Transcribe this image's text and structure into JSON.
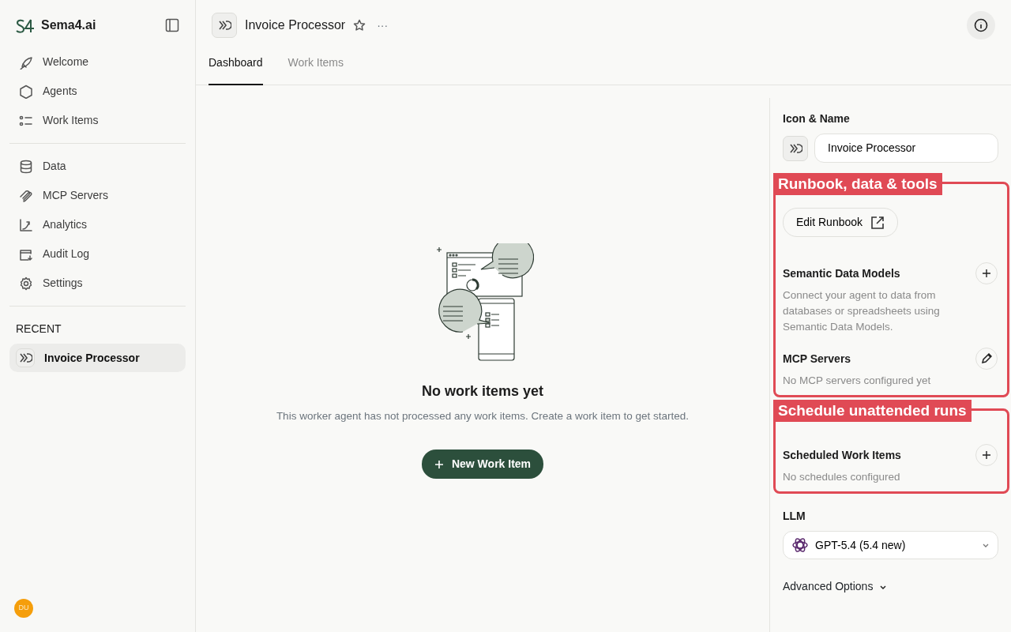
{
  "brand": {
    "name": "Sema4.ai"
  },
  "sidebar": {
    "groups": [
      {
        "items": [
          {
            "label": "Welcome",
            "selected": false
          },
          {
            "label": "Agents",
            "selected": false
          },
          {
            "label": "Work Items",
            "selected": false
          }
        ]
      },
      {
        "items": [
          {
            "label": "Data",
            "selected": false
          },
          {
            "label": "MCP Servers",
            "selected": false
          },
          {
            "label": "Analytics",
            "selected": false
          },
          {
            "label": "Audit Log",
            "selected": false
          },
          {
            "label": "Settings",
            "selected": false
          }
        ]
      }
    ],
    "recent": {
      "heading": "RECENT",
      "items": [
        {
          "label": "Invoice Processor",
          "selected": true
        }
      ]
    },
    "user": {
      "initials": "DU"
    }
  },
  "header": {
    "title": "Invoice Processor",
    "starred": false,
    "more": "···"
  },
  "tabs": [
    {
      "label": "Dashboard",
      "selected": true
    },
    {
      "label": "Work Items",
      "selected": false
    }
  ],
  "empty_state": {
    "title": "No work items yet",
    "message": "This worker agent has not processed any work items. Create a work item to get started.",
    "button": "New Work Item"
  },
  "settings_panel": {
    "icon_name": {
      "label": "Icon & Name",
      "value": "Invoice Processor"
    },
    "callouts": [
      {
        "label": "Runbook, data & tools",
        "items": [
          {
            "kind": "button",
            "label": "Edit Runbook"
          },
          {
            "kind": "add_section",
            "title": "Semantic Data Models",
            "description": "Connect your agent to data from databases or spreadsheets using Semantic Data Models."
          },
          {
            "kind": "edit_section",
            "title": "MCP Servers",
            "description": "No MCP servers configured yet"
          }
        ]
      },
      {
        "label": "Schedule unattended runs",
        "items": [
          {
            "kind": "add_section",
            "title": "Scheduled Work Items",
            "description": "No schedules configured"
          }
        ]
      }
    ],
    "llm": {
      "label": "LLM",
      "value": "GPT-5.4 (5.4 new)"
    },
    "advanced": {
      "label": "Advanced Options",
      "expanded": false
    }
  }
}
